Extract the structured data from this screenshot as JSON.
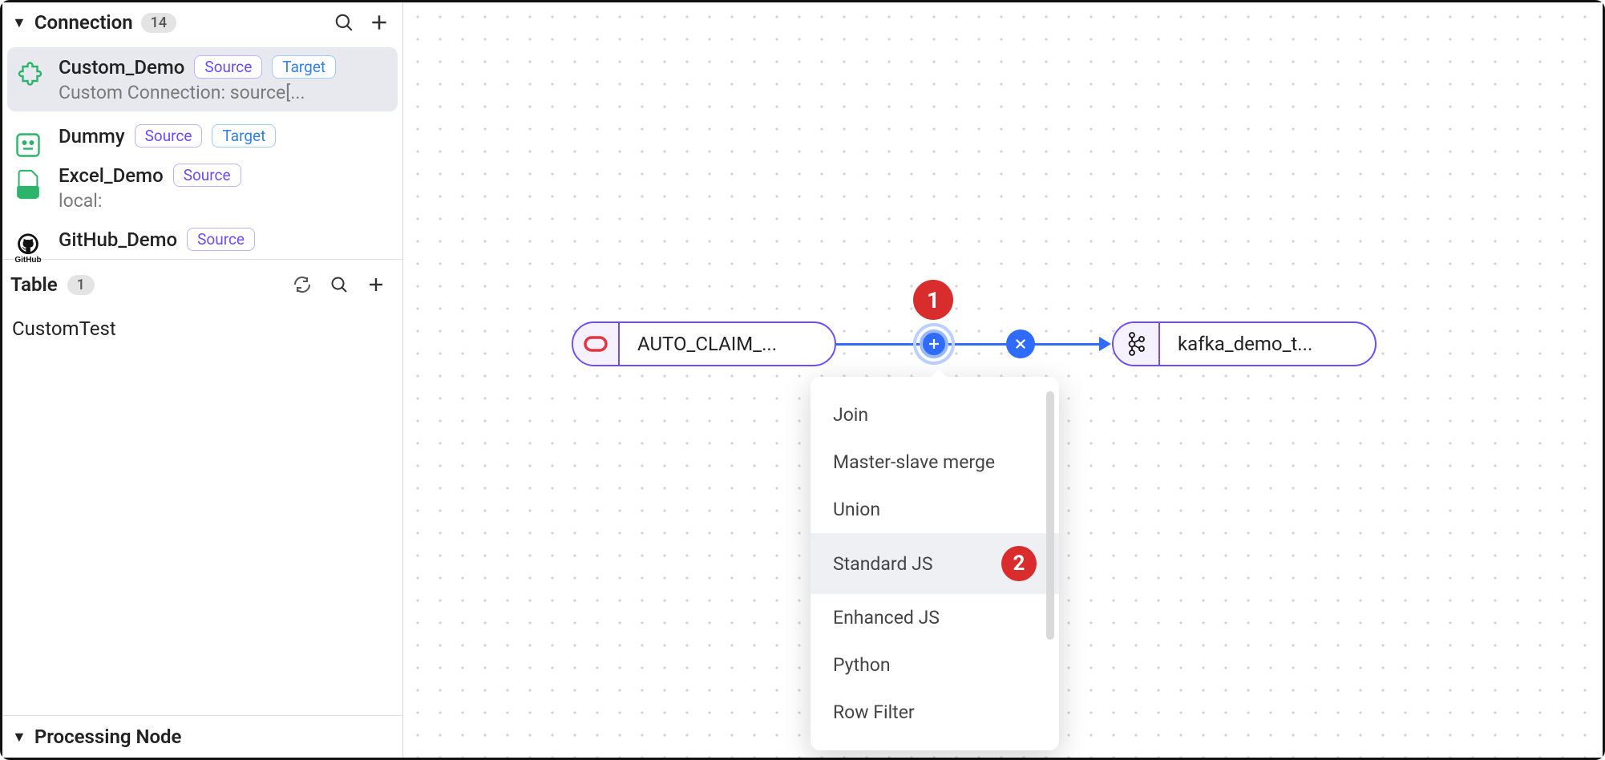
{
  "sidebar": {
    "connection": {
      "title": "Connection",
      "count": "14",
      "items": [
        {
          "name": "Custom_Demo",
          "tags": [
            "Source",
            "Target"
          ],
          "subtitle": "Custom Connection: source[...",
          "iconKind": "puzzle"
        },
        {
          "name": "Dummy",
          "tags": [
            "Source",
            "Target"
          ],
          "subtitle": "",
          "iconKind": "neutral"
        },
        {
          "name": "Excel_Demo",
          "tags": [
            "Source"
          ],
          "subtitle": "local:",
          "iconKind": "excel"
        },
        {
          "name": "GitHub_Demo",
          "tags": [
            "Source"
          ],
          "subtitle": "",
          "iconKind": "github"
        }
      ]
    },
    "table": {
      "title": "Table",
      "count": "1",
      "items": [
        "CustomTest"
      ]
    },
    "processing": {
      "title": "Processing Node"
    }
  },
  "canvas": {
    "nodeA": {
      "label": "AUTO_CLAIM_..."
    },
    "nodeB": {
      "label": "kafka_demo_t..."
    },
    "annotations": {
      "a1": "1",
      "a2": "2"
    },
    "menu": {
      "items": [
        "Join",
        "Master-slave merge",
        "Union",
        "Standard JS",
        "Enhanced JS",
        "Python",
        "Row Filter"
      ],
      "hoveredIndex": 3
    }
  }
}
